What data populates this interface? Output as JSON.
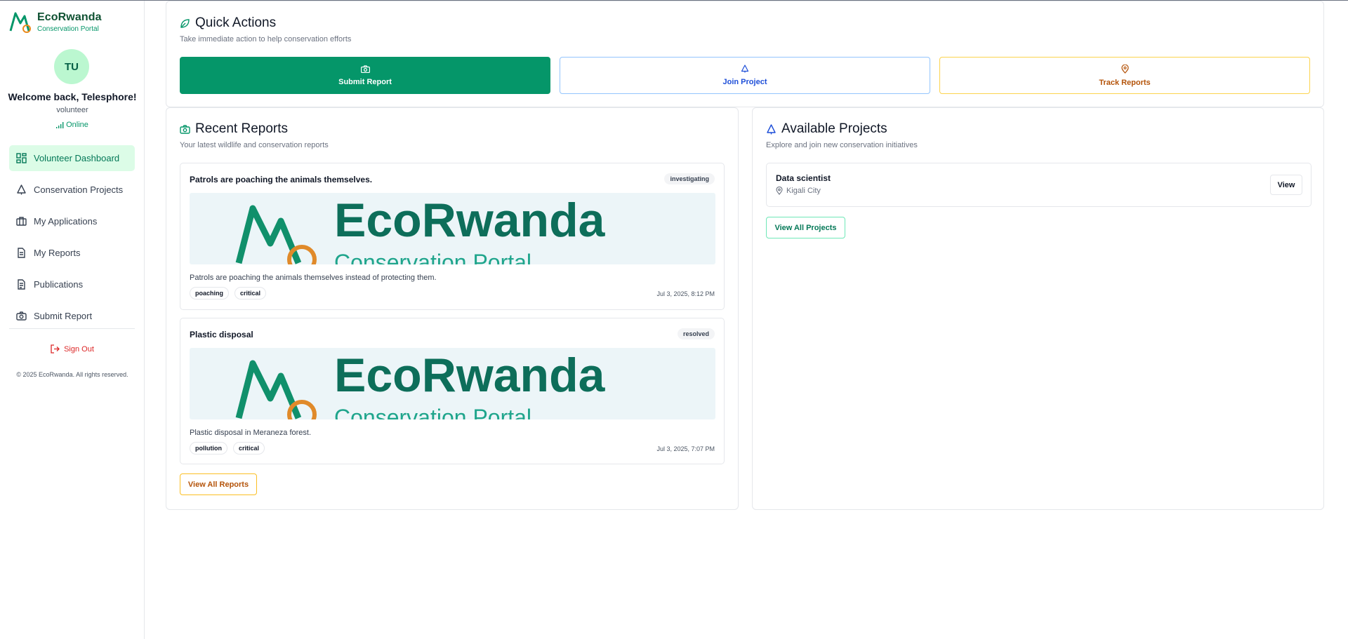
{
  "brand": {
    "name": "EcoRwanda",
    "subtitle": "Conservation Portal"
  },
  "user": {
    "initials": "TU",
    "welcome": "Welcome back, Telesphore!",
    "role": "volunteer",
    "status": "Online"
  },
  "nav": {
    "items": [
      {
        "label": "Volunteer Dashboard",
        "icon": "dashboard-icon",
        "active": true
      },
      {
        "label": "Conservation Projects",
        "icon": "tree-icon",
        "active": false
      },
      {
        "label": "My Applications",
        "icon": "briefcase-icon",
        "active": false
      },
      {
        "label": "My Reports",
        "icon": "file-icon",
        "active": false
      },
      {
        "label": "Publications",
        "icon": "document-icon",
        "active": false
      },
      {
        "label": "Submit Report",
        "icon": "camera-icon",
        "active": false
      }
    ],
    "sign_out": "Sign Out",
    "copyright": "© 2025 EcoRwanda. All rights reserved."
  },
  "quick_actions": {
    "title": "Quick Actions",
    "subtitle": "Take immediate action to help conservation efforts",
    "buttons": [
      {
        "label": "Submit Report",
        "icon": "camera-icon"
      },
      {
        "label": "Join Project",
        "icon": "tree-icon"
      },
      {
        "label": "Track Reports",
        "icon": "map-pin-icon"
      }
    ]
  },
  "recent_reports": {
    "title": "Recent Reports",
    "subtitle": "Your latest wildlife and conservation reports",
    "items": [
      {
        "title": "Patrols are poaching the animals themselves.",
        "status": "investigating",
        "image_text": "EcoRwanda",
        "image_subtext": "Conservation Portal",
        "description": "Patrols are poaching the animals themselves instead of protecting them.",
        "tags": [
          "poaching",
          "critical"
        ],
        "date": "Jul 3, 2025, 8:12 PM"
      },
      {
        "title": "Plastic disposal",
        "status": "resolved",
        "image_text": "EcoRwanda",
        "image_subtext": "Conservation Portal",
        "description": "Plastic disposal in Meraneza forest.",
        "tags": [
          "pollution",
          "critical"
        ],
        "date": "Jul 3, 2025, 7:07 PM"
      }
    ],
    "view_all": "View All Reports"
  },
  "available_projects": {
    "title": "Available Projects",
    "subtitle": "Explore and join new conservation initiatives",
    "items": [
      {
        "name": "Data scientist",
        "location": "Kigali City",
        "action": "View"
      }
    ],
    "view_all": "View All Projects"
  },
  "colors": {
    "brand_green": "#059669",
    "brand_dark": "#0f5132",
    "join_blue": "#1d4ed8",
    "track_amber": "#b45309",
    "signout_red": "#dc2626",
    "active_nav_bg": "#dcfce7"
  }
}
